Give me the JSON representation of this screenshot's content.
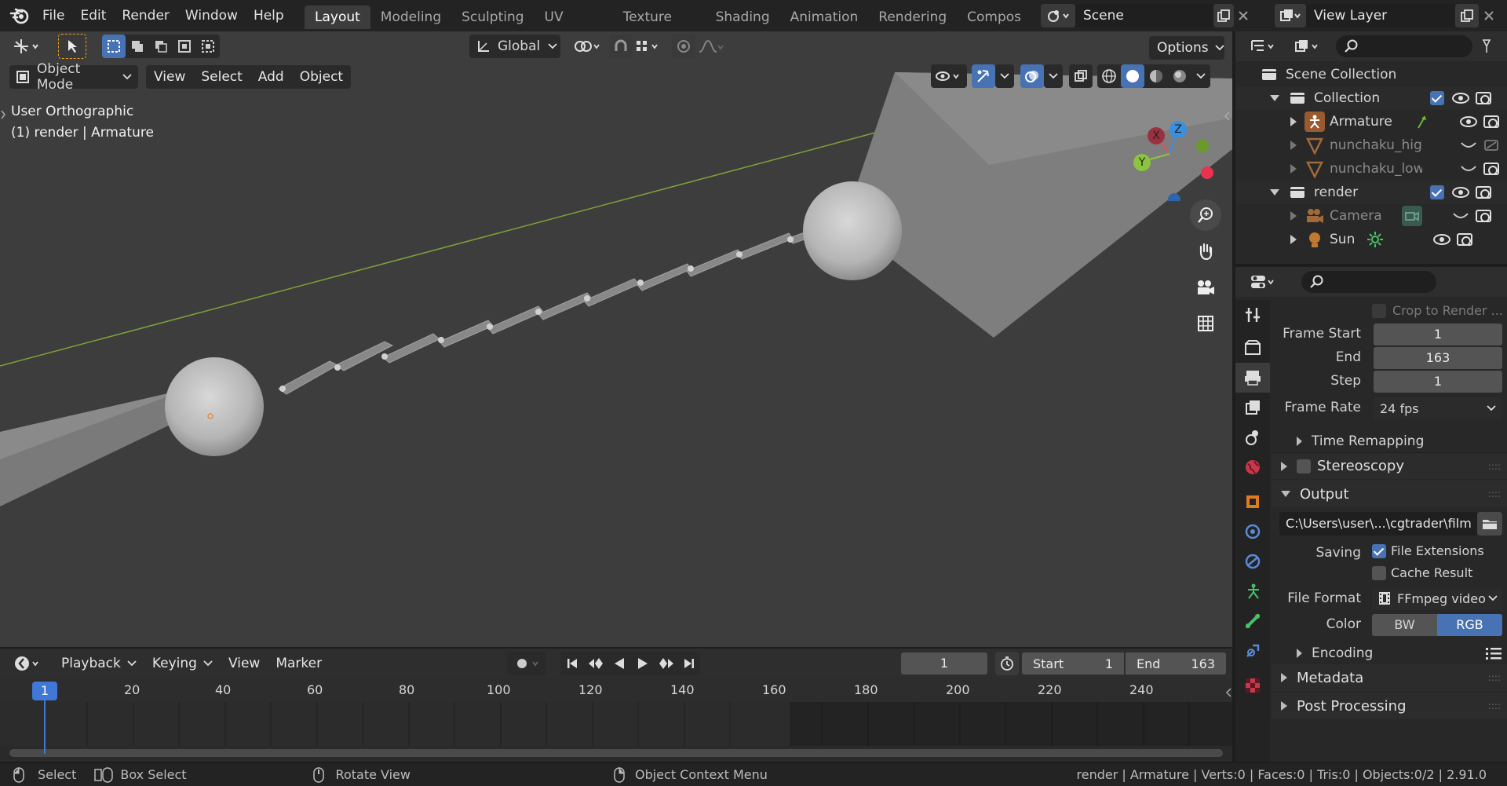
{
  "topbar": {
    "menus": [
      "File",
      "Edit",
      "Render",
      "Window",
      "Help"
    ],
    "workspaces": [
      "Layout",
      "Modeling",
      "Sculpting",
      "UV Editing",
      "Texture Paint",
      "Shading",
      "Animation",
      "Rendering",
      "Compos"
    ],
    "active_workspace": "Layout",
    "scene": "Scene",
    "view_layer": "View Layer"
  },
  "viewport": {
    "transform_orientation": "Global",
    "options_label": "Options",
    "mode": "Object Mode",
    "header_menus": [
      "View",
      "Select",
      "Add",
      "Object"
    ],
    "view_name": "User Orthographic",
    "view_info": "(1) render | Armature",
    "gizmo": {
      "x": "X",
      "y": "Y",
      "z": "Z"
    }
  },
  "timeline": {
    "menus": [
      "Playback",
      "Keying",
      "View",
      "Marker"
    ],
    "current_frame": "1",
    "start_label": "Start",
    "start": "1",
    "end_label": "End",
    "end": "163",
    "ruler": [
      "1",
      "20",
      "40",
      "60",
      "80",
      "100",
      "120",
      "140",
      "160",
      "180",
      "200",
      "220",
      "240"
    ]
  },
  "outliner": {
    "root": "Scene Collection",
    "items": [
      {
        "name": "Collection",
        "level": 0,
        "kind": "collection"
      },
      {
        "name": "Armature",
        "level": 1,
        "kind": "armature"
      },
      {
        "name": "nunchaku_high",
        "level": 1,
        "kind": "mesh"
      },
      {
        "name": "nunchaku_low",
        "level": 1,
        "kind": "mesh"
      },
      {
        "name": "render",
        "level": 0,
        "kind": "collection"
      },
      {
        "name": "Camera",
        "level": 1,
        "kind": "camera"
      },
      {
        "name": "Sun",
        "level": 1,
        "kind": "light"
      }
    ]
  },
  "properties": {
    "crop_label": "Crop to Render ...",
    "frame_start_label": "Frame Start",
    "frame_start": "1",
    "end_label": "End",
    "end": "163",
    "step_label": "Step",
    "step": "1",
    "frame_rate_label": "Frame Rate",
    "frame_rate": "24 fps",
    "time_remapping": "Time Remapping",
    "stereoscopy": "Stereoscopy",
    "output": "Output",
    "output_path": "C:\\Users\\user\\...\\cgtrader\\film",
    "saving_label": "Saving",
    "file_extensions": "File Extensions",
    "cache_result": "Cache Result",
    "file_format_label": "File Format",
    "file_format": "FFmpeg video",
    "color_label": "Color",
    "color_bw": "BW",
    "color_rgb": "RGB",
    "encoding": "Encoding",
    "metadata": "Metadata",
    "post_processing": "Post Processing"
  },
  "statusbar": {
    "select": "Select",
    "box_select": "Box Select",
    "rotate_view": "Rotate View",
    "context_menu": "Object Context Menu",
    "stats": "render | Armature | Verts:0 | Faces:0 | Tris:0 | Objects:0/2 | 2.91.0"
  },
  "colors": {
    "accent": "#4772b3",
    "x_axis": "#e05060",
    "y_axis": "#8bc53f",
    "z_axis": "#3a8fe0",
    "timeline_cursor": "#3f78d6"
  }
}
